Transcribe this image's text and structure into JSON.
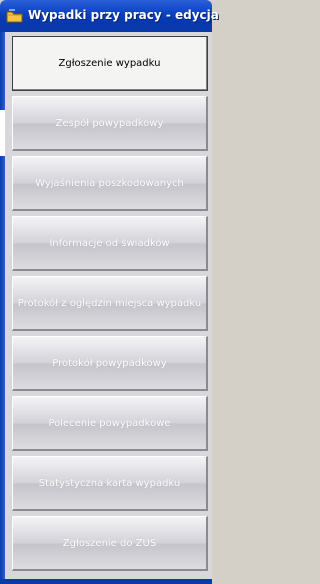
{
  "window": {
    "title": "Wypadki przy pracy - edycja",
    "title_icon": "folder-icon"
  },
  "menu": {
    "buttons": [
      {
        "label": "Zgłoszenie wypadku",
        "active": true
      },
      {
        "label": "Zespół powypadkowy",
        "active": false
      },
      {
        "label": "Wyjaśnienia poszkodowanych",
        "active": false
      },
      {
        "label": "Informacje od świadków",
        "active": false
      },
      {
        "label": "Protokół z oględzin miejsca wypadku",
        "active": false
      },
      {
        "label": "Protokół powypadkowy",
        "active": false
      },
      {
        "label": "Polecenie powypadkowe",
        "active": false
      },
      {
        "label": "Statystyczna karta wypadku",
        "active": false
      },
      {
        "label": "Zgłoszenie do ZUS",
        "active": false
      }
    ]
  },
  "colors": {
    "titlebar": "#0a3fbf",
    "active_text": "#000000",
    "inactive_text": "#ffffff"
  }
}
